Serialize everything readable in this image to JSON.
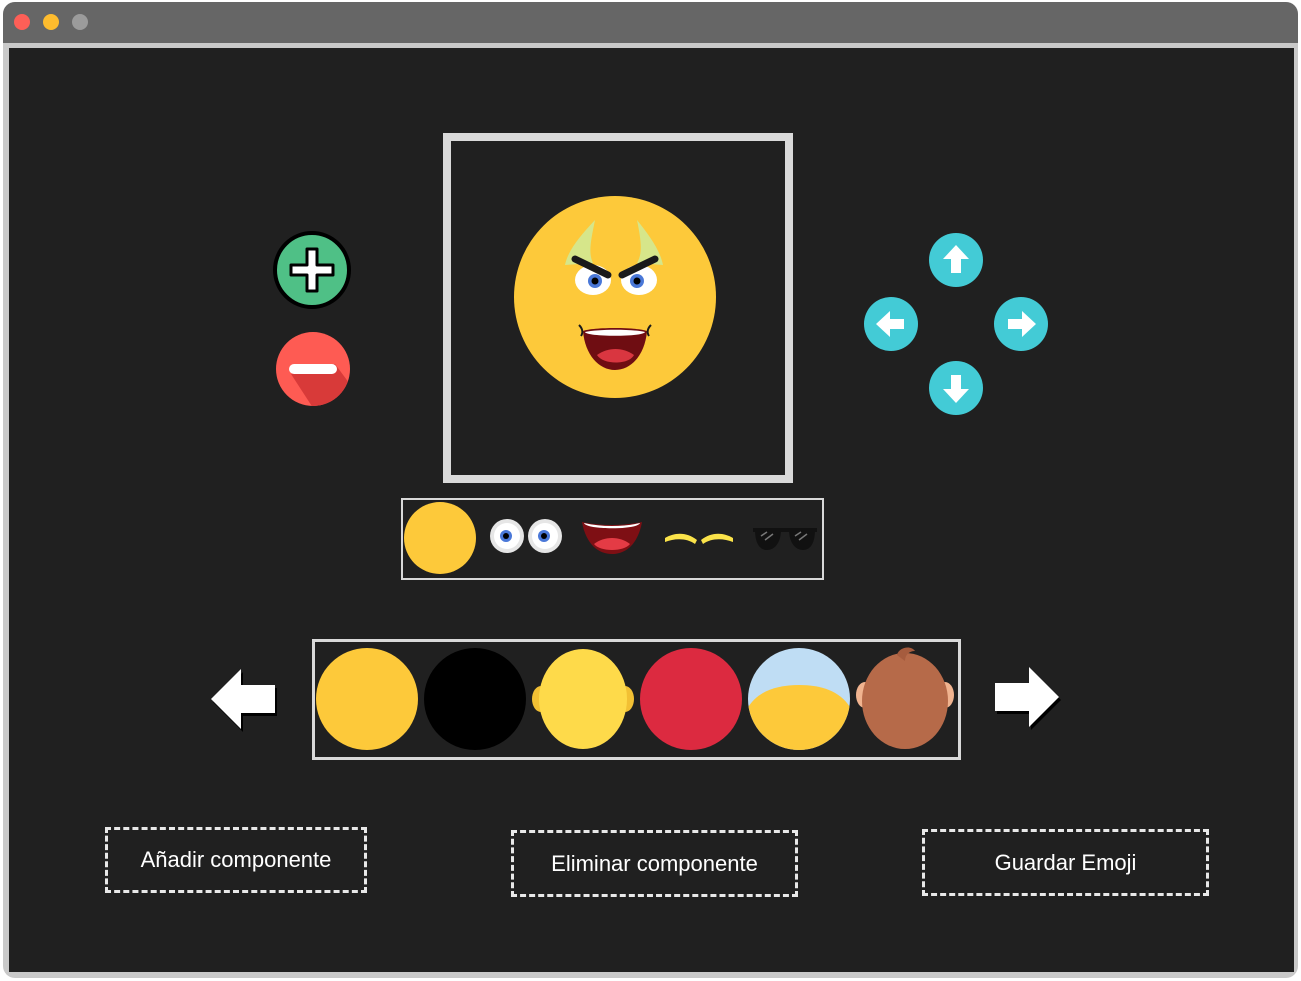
{
  "window": {
    "traffic_lights": [
      "close",
      "minimize",
      "maximize"
    ]
  },
  "editor": {
    "add_icon": "plus-circle-icon",
    "remove_icon": "minus-circle-icon",
    "move_controls": [
      "arrow-up-icon",
      "arrow-left-icon",
      "arrow-right-icon",
      "arrow-down-icon"
    ],
    "preview": {
      "face_color": "#FDC93A",
      "components": [
        "base",
        "eyes",
        "angry-eyebrows",
        "horns",
        "laughing-mouth"
      ]
    }
  },
  "component_strip": {
    "items": [
      "base-icon",
      "eyes-icon",
      "mouth-icon",
      "eyebrows-icon",
      "sunglasses-icon"
    ]
  },
  "skin_strip": {
    "items": [
      "yellow-face",
      "black-face",
      "yellow-face-with-ears",
      "red-face",
      "bald-face",
      "monkey-face"
    ],
    "colors": [
      "#FDC93A",
      "#000000",
      "#FEDA4A",
      "#DC2A40",
      "#FDC93A",
      "#B66A49"
    ]
  },
  "actions": {
    "add_label": "Añadir componente",
    "remove_label": "Eliminar componente",
    "save_label": "Guardar Emoji"
  },
  "colors": {
    "background": "#202020",
    "add_green": "#4FC086",
    "remove_red": "#FE5B53",
    "arrow_cyan": "#43CBD6"
  }
}
